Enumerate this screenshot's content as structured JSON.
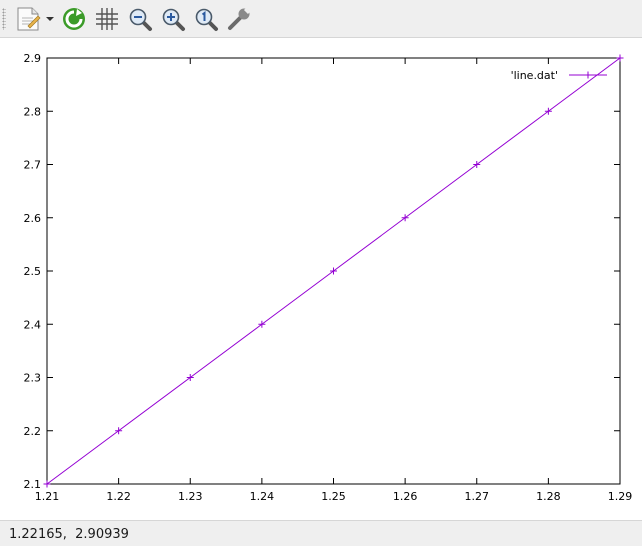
{
  "toolbar": {
    "buttons": [
      {
        "name": "export-menu-button",
        "icon": "document-export-icon"
      },
      {
        "name": "replot-button",
        "icon": "refresh-icon"
      },
      {
        "name": "grid-toggle-button",
        "icon": "grid-icon"
      },
      {
        "name": "zoom-previous-button",
        "icon": "zoom-out-icon"
      },
      {
        "name": "zoom-next-button",
        "icon": "zoom-in-icon"
      },
      {
        "name": "unzoom-button",
        "icon": "zoom-original-icon"
      },
      {
        "name": "settings-button",
        "icon": "wrench-icon"
      }
    ]
  },
  "status": {
    "mouse_coordinates": "1.22165,  2.90939"
  },
  "colors": {
    "series": "#9400d3",
    "background": "#efefef"
  },
  "chart_data": {
    "type": "line",
    "title": "",
    "xlabel": "",
    "ylabel": "",
    "xlim": [
      1.21,
      1.29
    ],
    "ylim": [
      2.1,
      2.9
    ],
    "x_ticks": [
      "1.21",
      "1.22",
      "1.23",
      "1.24",
      "1.25",
      "1.26",
      "1.27",
      "1.28",
      "1.29"
    ],
    "y_ticks": [
      "2.1",
      "2.2",
      "2.3",
      "2.4",
      "2.5",
      "2.6",
      "2.7",
      "2.8",
      "2.9"
    ],
    "grid": false,
    "legend_position": "top-right",
    "series": [
      {
        "name": "'line.dat'",
        "marker": "plus",
        "x": [
          1.21,
          1.22,
          1.23,
          1.24,
          1.25,
          1.26,
          1.27,
          1.28,
          1.29
        ],
        "y": [
          2.1,
          2.2,
          2.3,
          2.4,
          2.5,
          2.6,
          2.7,
          2.8,
          2.9
        ]
      }
    ]
  }
}
